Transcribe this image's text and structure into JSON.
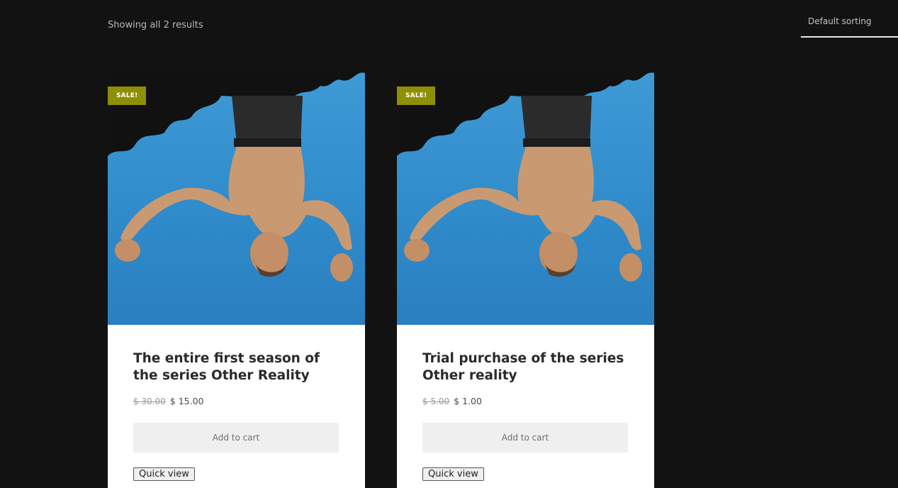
{
  "toolbar": {
    "result_count": "Showing all 2 results",
    "sorting": "Default sorting"
  },
  "products": [
    {
      "badge": "SALE!",
      "title": "The entire first season of the series Other Reality",
      "old_price": "$ 30.00",
      "price": "$ 15.00",
      "add_to_cart": "Add to cart",
      "quick_view": "Quick view"
    },
    {
      "badge": "SALE!",
      "title": "Trial purchase of the series Other reality",
      "old_price": "$ 5.00",
      "price": "$ 1.00",
      "add_to_cart": "Add to cart",
      "quick_view": "Quick view"
    }
  ],
  "colors": {
    "background": "#121212",
    "badge": "#8f8f06",
    "sky": "#2f8ac9"
  }
}
